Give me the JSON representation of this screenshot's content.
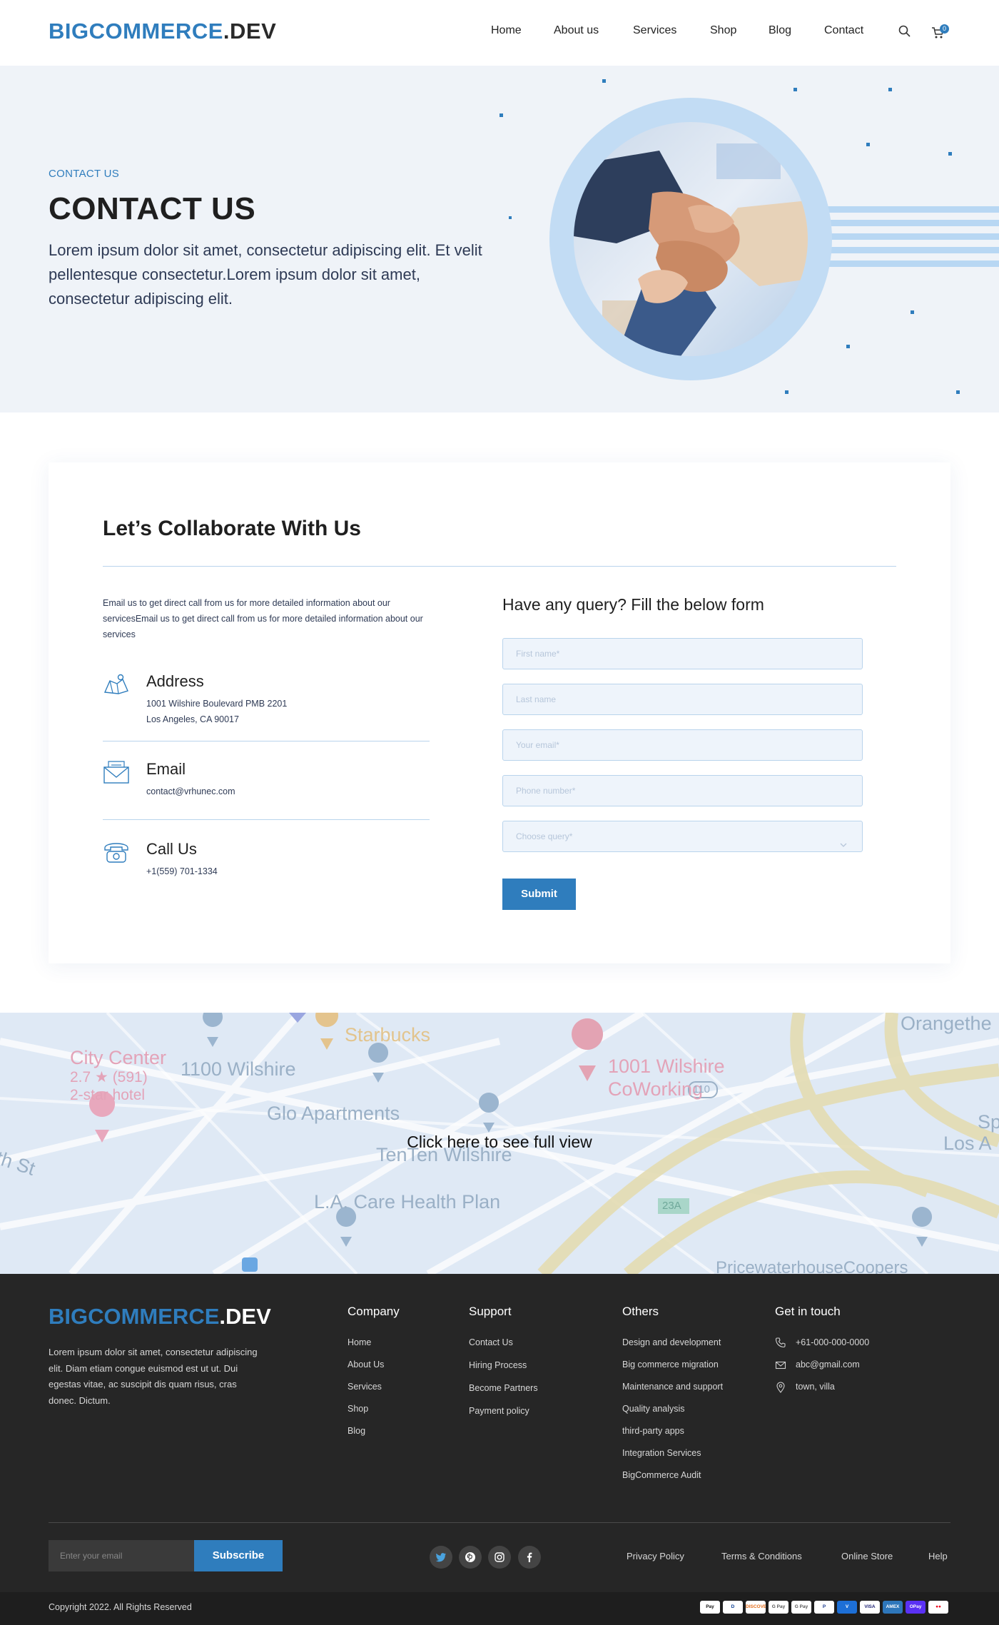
{
  "header": {
    "logo_main": "BIGCOMMERCE",
    "logo_suffix": ".DEV",
    "nav": [
      "Home",
      "About us",
      "Services",
      "Shop",
      "Blog",
      "Contact"
    ],
    "cart_count": "0"
  },
  "hero": {
    "kicker": "CONTACT US",
    "title": "CONTACT US",
    "text": "Lorem ipsum dolor sit amet, consectetur adipiscing elit. Et velit pellentesque consectetur.Lorem ipsum dolor sit amet, consectetur adipiscing elit."
  },
  "contact": {
    "title": "Let’s Collaborate With Us",
    "intro": "Email us to get direct call from us for more detailed information about our servicesEmail us to get direct call from us for more detailed information about our services",
    "address_title": "Address",
    "address_line1": "1001 Wilshire Boulevard PMB 2201",
    "address_line2": "Los Angeles, CA 90017",
    "email_title": "Email",
    "email_value": "contact@vrhunec.com",
    "call_title": "Call Us",
    "call_value": "+1(559) 701-1334"
  },
  "form": {
    "title": "Have any query? Fill the below form",
    "first_name": "First name*",
    "last_name": "Last name",
    "email": "Your email*",
    "phone": "Phone number*",
    "query": "Choose query*",
    "submit": "Submit"
  },
  "map": {
    "cta": "Click here to see full view",
    "labels": {
      "city_center": "City Center",
      "rating": "2.7 ★ (591)",
      "hotel": "2-star hotel",
      "wilshire_1100": "1100 Wilshire",
      "starbucks": "Starbucks",
      "coworking_1": "1001 Wilshire",
      "coworking_2": "CoWorking",
      "orangetheory": "Orangethe",
      "glo": "Glo Apartments",
      "tenten": "TenTen Wilshire",
      "care": "L.A. Care Health Plan",
      "th_st": "th St",
      "sp": "Sp",
      "los": "Los A",
      "pwc": "PricewaterhouseCoopers",
      "route_110": "110",
      "route_23a": "23A"
    }
  },
  "footer": {
    "logo_main": "BIGCOMMERCE",
    "logo_suffix": ".DEV",
    "about": "Lorem ipsum dolor sit amet, consectetur adipiscing elit. Diam etiam congue euismod est ut ut. Dui egestas vitae, ac suscipit dis quam risus, cras donec. Dictum.",
    "company_title": "Company",
    "company_links": [
      "Home",
      "About  Us",
      "Services",
      "Shop",
      "Blog"
    ],
    "support_title": "Support",
    "support_links": [
      "Contact Us",
      "Hiring Process",
      "Become Partners",
      "Payment policy"
    ],
    "others_title": "Others",
    "others_links": [
      "Design and development",
      "Big commerce migration",
      "Maintenance and support",
      "Quality analysis",
      "third-party apps",
      "Integration Services",
      "BigCommerce Audit"
    ],
    "touch_title": "Get in touch",
    "phone": "+61-000-000-0000",
    "email": "abc@gmail.com",
    "location": "town, villa",
    "email_placeholder": "Enter your email",
    "subscribe": "Subscribe",
    "bottom_links": [
      "Privacy Policy",
      "Terms & Conditions",
      "Online Store",
      "Help"
    ],
    "copyright": "Copyright 2022. All Rights Reserved",
    "payments": [
      {
        "label": "Pay",
        "bg": "#ffffff",
        "fg": "#111111"
      },
      {
        "label": "D",
        "bg": "#ffffff",
        "fg": "#0a3d91"
      },
      {
        "label": "DISCOVER",
        "bg": "#ffffff",
        "fg": "#e36f1e"
      },
      {
        "label": "G Pay",
        "bg": "#ffffff",
        "fg": "#555555"
      },
      {
        "label": "G Pay",
        "bg": "#ffffff",
        "fg": "#555555"
      },
      {
        "label": "P",
        "bg": "#ffffff",
        "fg": "#1a3b8f"
      },
      {
        "label": "V",
        "bg": "#1d6fd6",
        "fg": "#ffffff"
      },
      {
        "label": "VISA",
        "bg": "#ffffff",
        "fg": "#1a1f71"
      },
      {
        "label": "AMEX",
        "bg": "#2e77bb",
        "fg": "#ffffff"
      },
      {
        "label": "OPay",
        "bg": "#5a31f4",
        "fg": "#ffffff"
      },
      {
        "label": "●●",
        "bg": "#ffffff",
        "fg": "#eb001b"
      }
    ]
  }
}
